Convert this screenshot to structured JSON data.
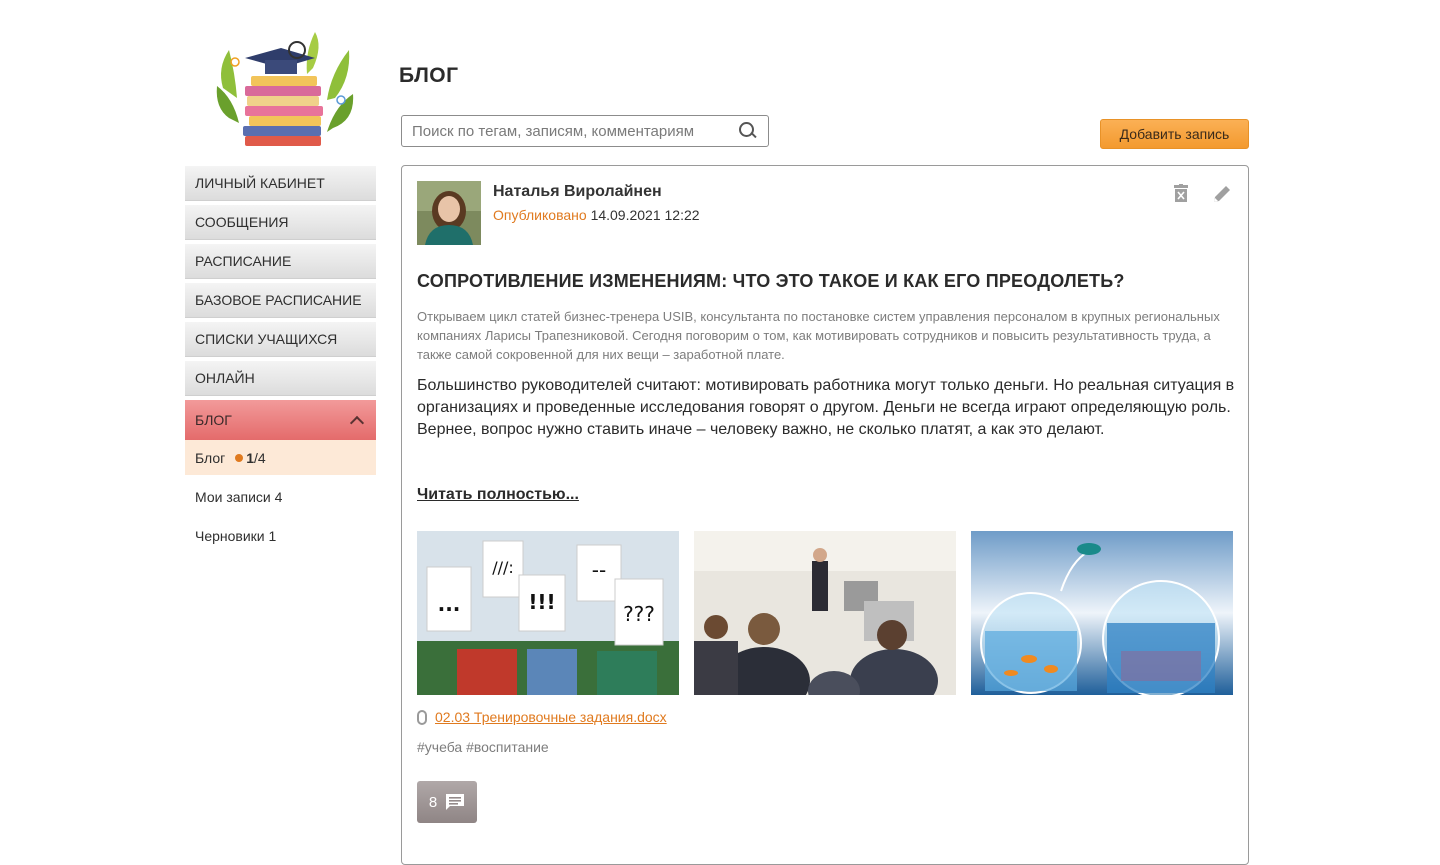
{
  "sidebar": {
    "nav": [
      {
        "label": "ЛИЧНЫЙ КАБИНЕТ"
      },
      {
        "label": "СООБЩЕНИЯ"
      },
      {
        "label": "РАСПИСАНИЕ"
      },
      {
        "label": "БАЗОВОЕ РАСПИСАНИЕ"
      },
      {
        "label": "СПИСКИ УЧАЩИХСЯ"
      },
      {
        "label": "ОНЛАЙН"
      }
    ],
    "active": {
      "label": "БЛОГ"
    },
    "sub": {
      "blog": {
        "label": "Блог",
        "count_new": "1",
        "count_total": "/4"
      },
      "my_posts": "Мои записи 4",
      "drafts": "Черновики 1"
    }
  },
  "page": {
    "title": "БЛОГ"
  },
  "search": {
    "placeholder": "Поиск по тегам, записям, комментариям"
  },
  "toolbar": {
    "add_label": "Добавить запись"
  },
  "post": {
    "author": "Наталья Виролайнен",
    "status": "Опубликовано",
    "date": "14.09.2021 12:22",
    "title": "СОПРОТИВЛЕНИЕ ИЗМЕНЕНИЯМ: ЧТО ЭТО ТАКОЕ И КАК ЕГО ПРЕОДОЛЕТЬ?",
    "lead": "Открываем цикл статей бизнес-тренера USIB, консультанта по постановке систем управления персоналом в крупных региональных компаниях Ларисы Трапезниковой. Сегодня поговорим о том, как мотивировать сотрудников и повысить результативность труда, а также самой сокровенной для них вещи – заработной плате.",
    "body": "Большинство руководителей считают: мотивировать работника могут только деньги. Но реальная ситуация в организациях и проведенные исследования говорят о другом. Деньги не всегда играют определяющую роль. Вернее, вопрос нужно ставить иначе – человеку важно, не сколько платят, а как это делают.",
    "read_more": "Читать полностью...",
    "image_captions": [
      "...",
      "///:",
      "!!!",
      "--",
      "???"
    ],
    "attachment": "02.03 Тренировочные задания.docx",
    "tags": "#учеба #воспитание",
    "comments_count": "8"
  },
  "colors": {
    "accent": "#e07a1f",
    "active_nav": "#e46b6b",
    "add_button": "#f39a2f"
  },
  "icons": [
    "logo-books-icon",
    "search-icon",
    "chevron-up-icon",
    "trash-icon",
    "pencil-icon",
    "paperclip-icon",
    "comment-icon"
  ]
}
